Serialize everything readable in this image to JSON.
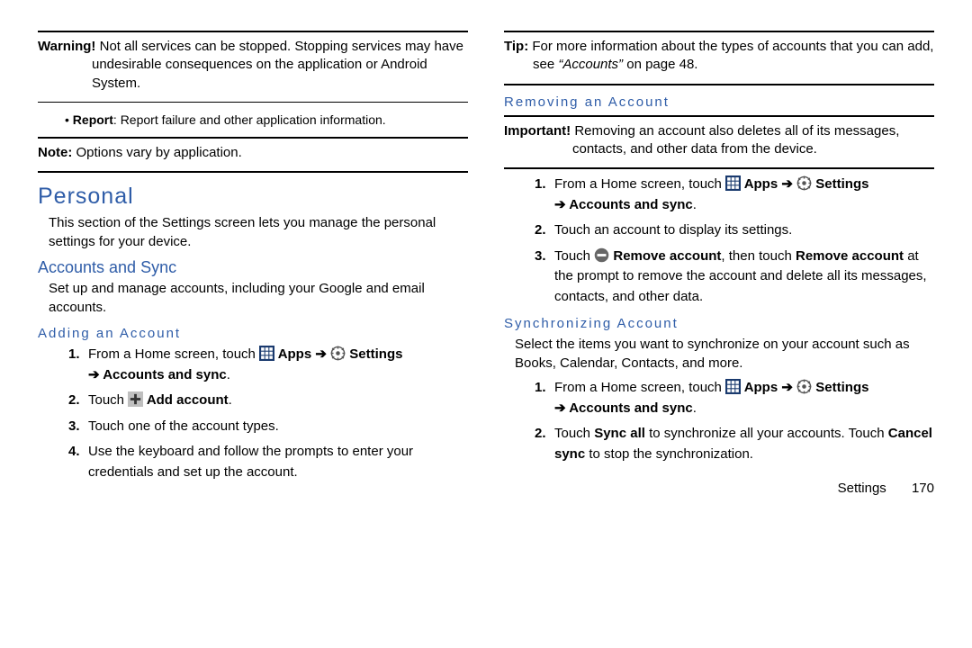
{
  "left": {
    "warning_label": "Warning!",
    "warning_text": " Not all services can be stopped. Stopping services may have undesirable consequences on the application or Android System.",
    "report_label": "Report",
    "report_text": ": Report failure and other application information.",
    "note_label": "Note:",
    "note_text": " Options vary by application.",
    "h1": "Personal",
    "personal_intro": "This section of the Settings screen lets you manage the personal settings for your device.",
    "h2_accounts": "Accounts and Sync",
    "accounts_intro": "Set up and manage accounts, including your Google and email accounts.",
    "h3_adding": "Adding an Account",
    "step1_pre": "From a Home screen, touch ",
    "apps": " Apps",
    "arrow": " ➔ ",
    "settings": " Settings",
    "arrow2": "➔ ",
    "acct_sync": "Accounts and sync",
    "step2_pre": "Touch ",
    "add_account": " Add account",
    "step3": "Touch one of the account types.",
    "step4": "Use the keyboard and follow the prompts to enter your credentials and set up the account."
  },
  "right": {
    "tip_label": "Tip:",
    "tip_text_a": " For more information about the types of accounts that you can add, see ",
    "tip_em": "“Accounts”",
    "tip_text_b": " on page 48.",
    "h3_removing": "Removing an Account",
    "important_label": "Important!",
    "important_text": " Removing an account also deletes all of its messages, contacts, and other data from the device.",
    "r_step1_pre": "From a Home screen, touch ",
    "r_step2": "Touch an account to display its settings.",
    "r_step3_pre": "Touch ",
    "remove_acct": " Remove account",
    "r_step3_mid": ", then touch ",
    "remove_acct2": "Remove account",
    "r_step3_post": " at the prompt to remove the account and delete all its messages, contacts, and other data.",
    "h3_sync": "Synchronizing Account",
    "sync_intro": "Select the items you want to synchronize on your account such as Books, Calendar, Contacts, and more.",
    "s_step1_pre": "From a Home screen, touch ",
    "s_step2_a": "Touch ",
    "sync_all": "Sync all",
    "s_step2_b": " to synchronize all your accounts. Touch ",
    "cancel_sync": "Cancel sync",
    "s_step2_c": " to stop the synchronization."
  },
  "footer": {
    "section": "Settings",
    "page": "170"
  }
}
